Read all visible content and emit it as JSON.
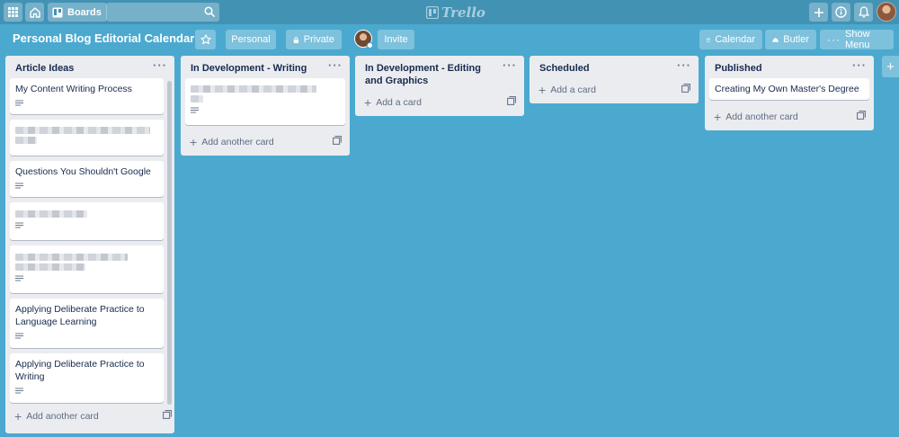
{
  "topnav": {
    "apps_icon": "grid-icon",
    "home_icon": "home-icon",
    "boards_label": "Boards",
    "search": {
      "value": "",
      "placeholder": ""
    },
    "logo_text": "Trello",
    "right_icons": [
      "plus-icon",
      "info-icon",
      "bell-icon"
    ]
  },
  "board": {
    "title": "Personal Blog Editorial Calendar",
    "team_label": "Personal",
    "visibility_label": "Private",
    "invite_label": "Invite",
    "calendar_label": "Calendar",
    "butler_label": "Butler",
    "menu_label": "Show Menu"
  },
  "lists": [
    {
      "title": "Article Ideas",
      "cards": [
        {
          "title": "My Content Writing Process",
          "blurred": false
        },
        {
          "title": "",
          "blurred": true
        },
        {
          "title": "Questions You Shouldn't Google",
          "blurred": false
        },
        {
          "title": "",
          "blurred": true
        },
        {
          "title": "",
          "blurred": true
        },
        {
          "title": "Applying Deliberate Practice to Language Learning",
          "blurred": false
        },
        {
          "title": "Applying Deliberate Practice to Writing",
          "blurred": false
        }
      ],
      "add_label": "Add another card"
    },
    {
      "title": "In Development - Writing",
      "cards": [
        {
          "title": "",
          "blurred": true
        }
      ],
      "add_label": "Add another card"
    },
    {
      "title": "In Development - Editing and Graphics",
      "cards": [],
      "add_label": "Add a card"
    },
    {
      "title": "Scheduled",
      "cards": [],
      "add_label": "Add a card"
    },
    {
      "title": "Published",
      "cards": [
        {
          "title": "Creating My Own Master's Degree",
          "blurred": false
        }
      ],
      "add_label": "Add another card"
    }
  ],
  "colors": {
    "board_bg": "#4ba9cf",
    "nav_bg": "#4292b4",
    "list_bg": "#ebecf0",
    "card_bg": "#ffffff",
    "text": "#172b4d"
  }
}
